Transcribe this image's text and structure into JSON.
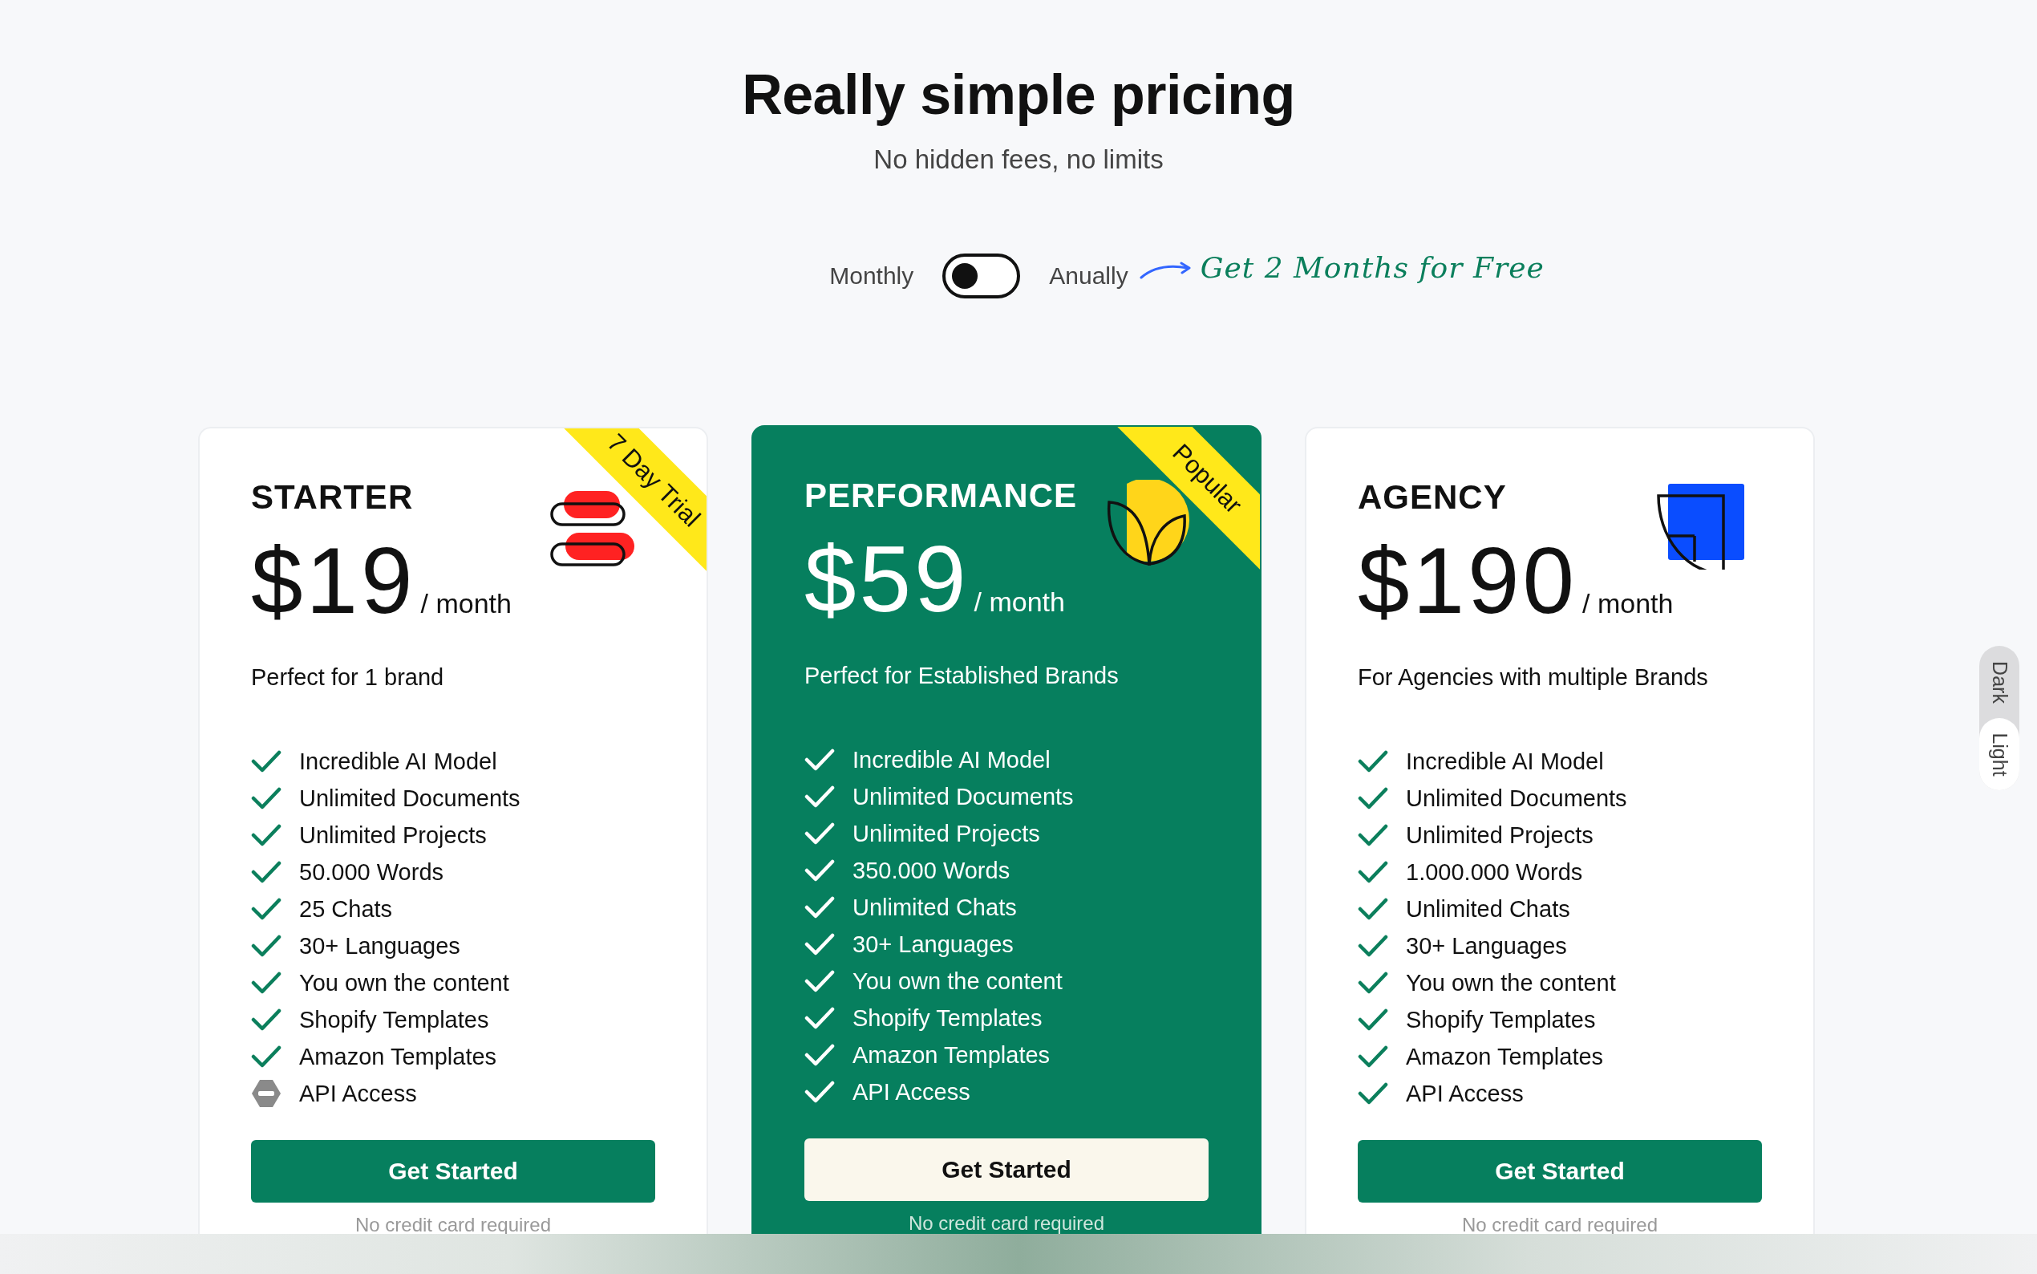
{
  "header": {
    "title": "Really simple pricing",
    "subtitle": "No hidden fees, no limits"
  },
  "billing": {
    "left_label": "Monthly",
    "right_label": "Anually",
    "on": false,
    "promo": "Get 2 Months for Free"
  },
  "plans": [
    {
      "name": "STARTER",
      "featured": false,
      "ribbon": "7 Day Trial",
      "currency": "$",
      "price": "19",
      "period": "/ month",
      "tagline": "Perfect for 1 brand",
      "features": [
        {
          "text": "Incredible AI Model",
          "included": true
        },
        {
          "text": "Unlimited Documents",
          "included": true
        },
        {
          "text": "Unlimited Projects",
          "included": true
        },
        {
          "text": "50.000 Words",
          "included": true
        },
        {
          "text": "25 Chats",
          "included": true
        },
        {
          "text": "30+ Languages",
          "included": true
        },
        {
          "text": "You own the content",
          "included": true
        },
        {
          "text": "Shopify Templates",
          "included": true
        },
        {
          "text": "Amazon Templates",
          "included": true
        },
        {
          "text": "API Access",
          "included": false
        }
      ],
      "button": "Get Started",
      "note": "No credit card required"
    },
    {
      "name": "PERFORMANCE",
      "featured": true,
      "ribbon": "Popular",
      "currency": "$",
      "price": "59",
      "period": "/ month",
      "tagline": "Perfect for Established Brands",
      "features": [
        {
          "text": "Incredible AI Model",
          "included": true
        },
        {
          "text": "Unlimited Documents",
          "included": true
        },
        {
          "text": "Unlimited Projects",
          "included": true
        },
        {
          "text": "350.000 Words",
          "included": true
        },
        {
          "text": "Unlimited Chats",
          "included": true
        },
        {
          "text": "30+ Languages",
          "included": true
        },
        {
          "text": "You own the content",
          "included": true
        },
        {
          "text": "Shopify Templates",
          "included": true
        },
        {
          "text": "Amazon Templates",
          "included": true
        },
        {
          "text": "API Access",
          "included": true
        }
      ],
      "button": "Get Started",
      "note": "No credit card required"
    },
    {
      "name": "AGENCY",
      "featured": false,
      "currency": "$",
      "price": "190",
      "period": "/ month",
      "tagline": "For Agencies with multiple Brands",
      "features": [
        {
          "text": "Incredible AI Model",
          "included": true
        },
        {
          "text": "Unlimited Documents",
          "included": true
        },
        {
          "text": "Unlimited Projects",
          "included": true
        },
        {
          "text": "1.000.000 Words",
          "included": true
        },
        {
          "text": "Unlimited Chats",
          "included": true
        },
        {
          "text": "30+ Languages",
          "included": true
        },
        {
          "text": "You own the content",
          "included": true
        },
        {
          "text": "Shopify Templates",
          "included": true
        },
        {
          "text": "Amazon Templates",
          "included": true
        },
        {
          "text": "API Access",
          "included": true
        }
      ],
      "button": "Get Started",
      "note": "No credit card required"
    }
  ],
  "theme_switch": [
    {
      "label": "Dark",
      "selected": false
    },
    {
      "label": "Light",
      "selected": true
    }
  ]
}
